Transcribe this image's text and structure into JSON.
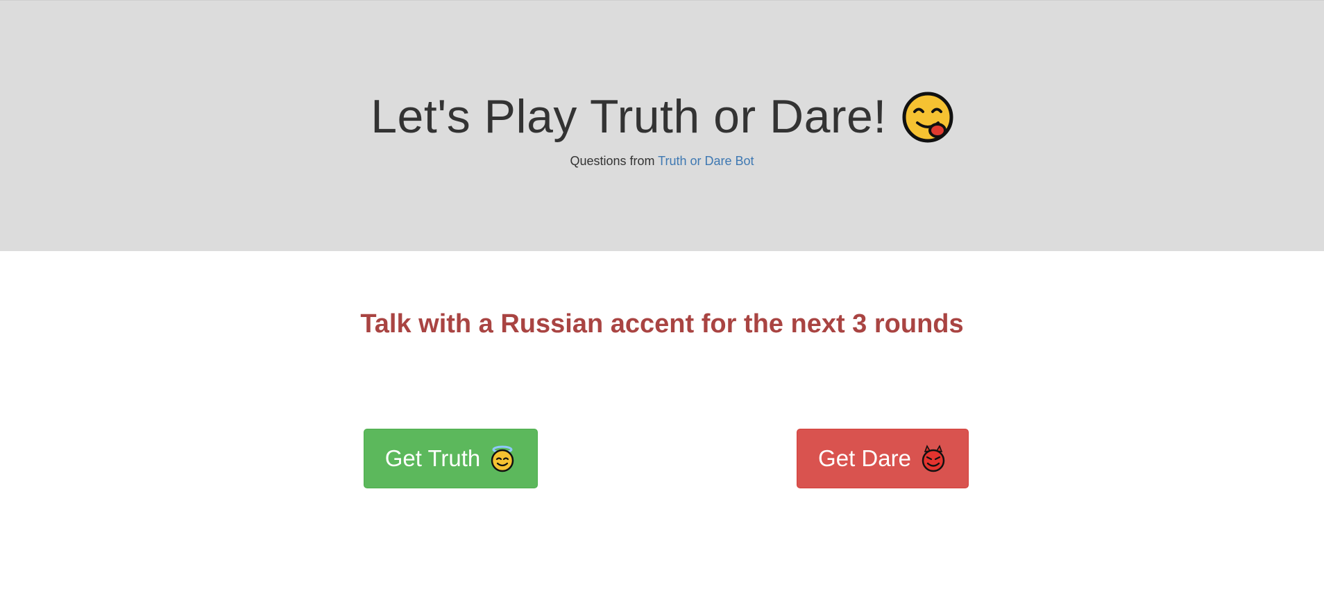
{
  "hero": {
    "title": "Let's Play Truth or Dare!",
    "title_emoji": "face-savoring-food-icon",
    "subtitle_prefix": "Questions from",
    "subtitle_link": "Truth or Dare Bot"
  },
  "question": {
    "text": "Talk with a Russian accent for the next 3 rounds",
    "color": "#a94442"
  },
  "buttons": {
    "truth": {
      "label": "Get Truth",
      "emoji": "angel-face-icon",
      "color": "#5cb85c"
    },
    "dare": {
      "label": "Get Dare",
      "emoji": "devil-face-icon",
      "color": "#d9534f"
    }
  }
}
